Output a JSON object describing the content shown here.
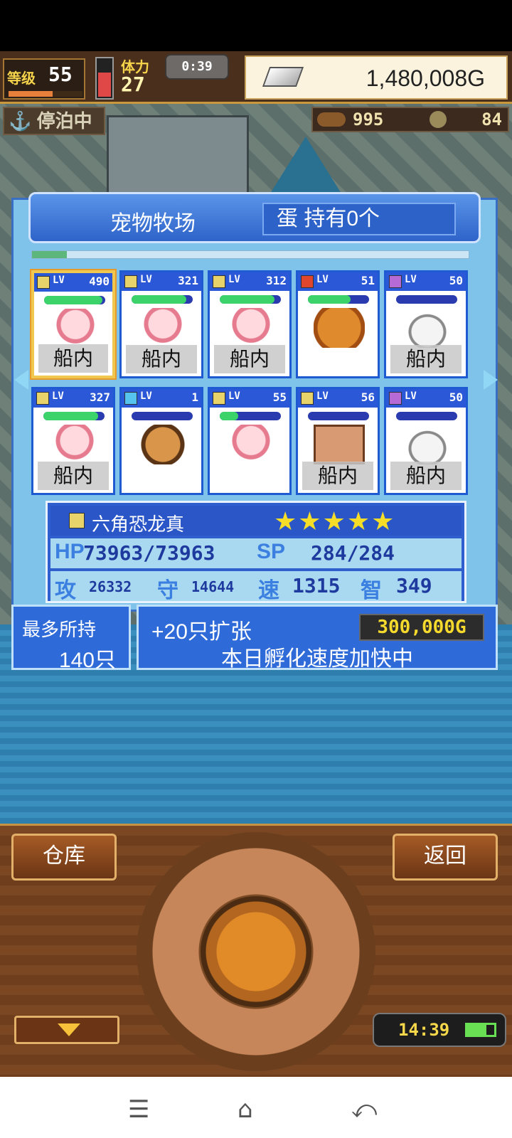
{
  "hud": {
    "level_tag": "等级",
    "level": "55",
    "stamina_label": "体力",
    "stamina": "27",
    "timer": "0:39",
    "gold": "1,480,008G",
    "dock_status": "停泊中",
    "resource_1": "995",
    "resource_2": "84"
  },
  "ranch": {
    "title": "宠物牧场",
    "eggs_label": "蛋 持有0个",
    "pets": [
      {
        "lv_label": "LV",
        "lv": "490",
        "loc": "船内",
        "element": "yellow",
        "type": "axo",
        "hp_pct": 95,
        "selected": true
      },
      {
        "lv_label": "LV",
        "lv": "321",
        "loc": "船内",
        "element": "yellow",
        "type": "axo",
        "hp_pct": 90
      },
      {
        "lv_label": "LV",
        "lv": "312",
        "loc": "船内",
        "element": "yellow",
        "type": "axo",
        "hp_pct": 90
      },
      {
        "lv_label": "LV",
        "lv": "51",
        "loc": "",
        "element": "red",
        "type": "dragon",
        "hp_pct": 70
      },
      {
        "lv_label": "LV",
        "lv": "50",
        "loc": "船内",
        "element": "purple",
        "type": "cat",
        "hp_pct": 0
      },
      {
        "lv_label": "LV",
        "lv": "327",
        "loc": "船内",
        "element": "yellow",
        "type": "axo",
        "hp_pct": 90
      },
      {
        "lv_label": "LV",
        "lv": "1",
        "loc": "",
        "element": "blue",
        "type": "hermit",
        "hp_pct": 0
      },
      {
        "lv_label": "LV",
        "lv": "55",
        "loc": "",
        "element": "yellow",
        "type": "axo",
        "hp_pct": 30
      },
      {
        "lv_label": "LV",
        "lv": "56",
        "loc": "船内",
        "element": "yellow",
        "type": "block",
        "hp_pct": 0
      },
      {
        "lv_label": "LV",
        "lv": "50",
        "loc": "船内",
        "element": "purple",
        "type": "cat",
        "hp_pct": 0
      }
    ]
  },
  "detail": {
    "name": "六角恐龙真",
    "stars": "★★★★★",
    "hp_label": "HP",
    "hp": "73963/73963",
    "sp_label": "SP",
    "sp": "284/284",
    "atk_label": "攻",
    "atk": "26332",
    "def_label": "守",
    "def": "14644",
    "spd_label": "速",
    "spd": "1315",
    "int_label": "智",
    "int": "349"
  },
  "capacity": {
    "label": "最多所持",
    "value": "140只"
  },
  "expand": {
    "label": "+20只扩张",
    "price": "300,000G",
    "notice": "本日孵化速度加快中"
  },
  "controls": {
    "store": "仓库",
    "back": "返回",
    "clock": "14:39"
  },
  "navbar": {
    "menu": "☰",
    "home": "⌂",
    "back": "⤺"
  },
  "colors": {
    "yellow": "#e8d36a",
    "red": "#e0462e",
    "purple": "#b66ad6",
    "blue": "#56c3ef"
  }
}
